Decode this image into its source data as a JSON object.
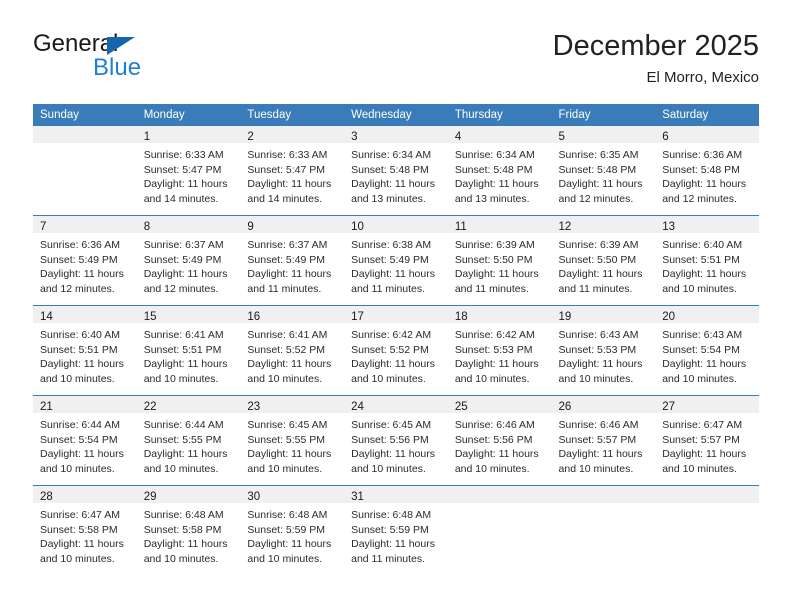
{
  "brand": {
    "name_top": "General",
    "name_bottom": "Blue",
    "triangle_icon": "triangle-icon",
    "accent_color": "#1f7fd4",
    "triangle_color": "#1565b0"
  },
  "header": {
    "title": "December 2025",
    "subtitle": "El Morro, Mexico"
  },
  "theme": {
    "header_blue": "#3a7cb9",
    "daynum_band": "#f0f0f0",
    "body_white": "#ffffff",
    "text_color": "#2b2b2b"
  },
  "weekdays": [
    "Sunday",
    "Monday",
    "Tuesday",
    "Wednesday",
    "Thursday",
    "Friday",
    "Saturday"
  ],
  "weeks": [
    [
      {
        "day": "",
        "sunrise": "",
        "sunset": "",
        "daylight_line1": "",
        "daylight_line2": ""
      },
      {
        "day": "1",
        "sunrise": "Sunrise: 6:33 AM",
        "sunset": "Sunset: 5:47 PM",
        "daylight_line1": "Daylight: 11 hours",
        "daylight_line2": "and 14 minutes."
      },
      {
        "day": "2",
        "sunrise": "Sunrise: 6:33 AM",
        "sunset": "Sunset: 5:47 PM",
        "daylight_line1": "Daylight: 11 hours",
        "daylight_line2": "and 14 minutes."
      },
      {
        "day": "3",
        "sunrise": "Sunrise: 6:34 AM",
        "sunset": "Sunset: 5:48 PM",
        "daylight_line1": "Daylight: 11 hours",
        "daylight_line2": "and 13 minutes."
      },
      {
        "day": "4",
        "sunrise": "Sunrise: 6:34 AM",
        "sunset": "Sunset: 5:48 PM",
        "daylight_line1": "Daylight: 11 hours",
        "daylight_line2": "and 13 minutes."
      },
      {
        "day": "5",
        "sunrise": "Sunrise: 6:35 AM",
        "sunset": "Sunset: 5:48 PM",
        "daylight_line1": "Daylight: 11 hours",
        "daylight_line2": "and 12 minutes."
      },
      {
        "day": "6",
        "sunrise": "Sunrise: 6:36 AM",
        "sunset": "Sunset: 5:48 PM",
        "daylight_line1": "Daylight: 11 hours",
        "daylight_line2": "and 12 minutes."
      }
    ],
    [
      {
        "day": "7",
        "sunrise": "Sunrise: 6:36 AM",
        "sunset": "Sunset: 5:49 PM",
        "daylight_line1": "Daylight: 11 hours",
        "daylight_line2": "and 12 minutes."
      },
      {
        "day": "8",
        "sunrise": "Sunrise: 6:37 AM",
        "sunset": "Sunset: 5:49 PM",
        "daylight_line1": "Daylight: 11 hours",
        "daylight_line2": "and 12 minutes."
      },
      {
        "day": "9",
        "sunrise": "Sunrise: 6:37 AM",
        "sunset": "Sunset: 5:49 PM",
        "daylight_line1": "Daylight: 11 hours",
        "daylight_line2": "and 11 minutes."
      },
      {
        "day": "10",
        "sunrise": "Sunrise: 6:38 AM",
        "sunset": "Sunset: 5:49 PM",
        "daylight_line1": "Daylight: 11 hours",
        "daylight_line2": "and 11 minutes."
      },
      {
        "day": "11",
        "sunrise": "Sunrise: 6:39 AM",
        "sunset": "Sunset: 5:50 PM",
        "daylight_line1": "Daylight: 11 hours",
        "daylight_line2": "and 11 minutes."
      },
      {
        "day": "12",
        "sunrise": "Sunrise: 6:39 AM",
        "sunset": "Sunset: 5:50 PM",
        "daylight_line1": "Daylight: 11 hours",
        "daylight_line2": "and 11 minutes."
      },
      {
        "day": "13",
        "sunrise": "Sunrise: 6:40 AM",
        "sunset": "Sunset: 5:51 PM",
        "daylight_line1": "Daylight: 11 hours",
        "daylight_line2": "and 10 minutes."
      }
    ],
    [
      {
        "day": "14",
        "sunrise": "Sunrise: 6:40 AM",
        "sunset": "Sunset: 5:51 PM",
        "daylight_line1": "Daylight: 11 hours",
        "daylight_line2": "and 10 minutes."
      },
      {
        "day": "15",
        "sunrise": "Sunrise: 6:41 AM",
        "sunset": "Sunset: 5:51 PM",
        "daylight_line1": "Daylight: 11 hours",
        "daylight_line2": "and 10 minutes."
      },
      {
        "day": "16",
        "sunrise": "Sunrise: 6:41 AM",
        "sunset": "Sunset: 5:52 PM",
        "daylight_line1": "Daylight: 11 hours",
        "daylight_line2": "and 10 minutes."
      },
      {
        "day": "17",
        "sunrise": "Sunrise: 6:42 AM",
        "sunset": "Sunset: 5:52 PM",
        "daylight_line1": "Daylight: 11 hours",
        "daylight_line2": "and 10 minutes."
      },
      {
        "day": "18",
        "sunrise": "Sunrise: 6:42 AM",
        "sunset": "Sunset: 5:53 PM",
        "daylight_line1": "Daylight: 11 hours",
        "daylight_line2": "and 10 minutes."
      },
      {
        "day": "19",
        "sunrise": "Sunrise: 6:43 AM",
        "sunset": "Sunset: 5:53 PM",
        "daylight_line1": "Daylight: 11 hours",
        "daylight_line2": "and 10 minutes."
      },
      {
        "day": "20",
        "sunrise": "Sunrise: 6:43 AM",
        "sunset": "Sunset: 5:54 PM",
        "daylight_line1": "Daylight: 11 hours",
        "daylight_line2": "and 10 minutes."
      }
    ],
    [
      {
        "day": "21",
        "sunrise": "Sunrise: 6:44 AM",
        "sunset": "Sunset: 5:54 PM",
        "daylight_line1": "Daylight: 11 hours",
        "daylight_line2": "and 10 minutes."
      },
      {
        "day": "22",
        "sunrise": "Sunrise: 6:44 AM",
        "sunset": "Sunset: 5:55 PM",
        "daylight_line1": "Daylight: 11 hours",
        "daylight_line2": "and 10 minutes."
      },
      {
        "day": "23",
        "sunrise": "Sunrise: 6:45 AM",
        "sunset": "Sunset: 5:55 PM",
        "daylight_line1": "Daylight: 11 hours",
        "daylight_line2": "and 10 minutes."
      },
      {
        "day": "24",
        "sunrise": "Sunrise: 6:45 AM",
        "sunset": "Sunset: 5:56 PM",
        "daylight_line1": "Daylight: 11 hours",
        "daylight_line2": "and 10 minutes."
      },
      {
        "day": "25",
        "sunrise": "Sunrise: 6:46 AM",
        "sunset": "Sunset: 5:56 PM",
        "daylight_line1": "Daylight: 11 hours",
        "daylight_line2": "and 10 minutes."
      },
      {
        "day": "26",
        "sunrise": "Sunrise: 6:46 AM",
        "sunset": "Sunset: 5:57 PM",
        "daylight_line1": "Daylight: 11 hours",
        "daylight_line2": "and 10 minutes."
      },
      {
        "day": "27",
        "sunrise": "Sunrise: 6:47 AM",
        "sunset": "Sunset: 5:57 PM",
        "daylight_line1": "Daylight: 11 hours",
        "daylight_line2": "and 10 minutes."
      }
    ],
    [
      {
        "day": "28",
        "sunrise": "Sunrise: 6:47 AM",
        "sunset": "Sunset: 5:58 PM",
        "daylight_line1": "Daylight: 11 hours",
        "daylight_line2": "and 10 minutes."
      },
      {
        "day": "29",
        "sunrise": "Sunrise: 6:48 AM",
        "sunset": "Sunset: 5:58 PM",
        "daylight_line1": "Daylight: 11 hours",
        "daylight_line2": "and 10 minutes."
      },
      {
        "day": "30",
        "sunrise": "Sunrise: 6:48 AM",
        "sunset": "Sunset: 5:59 PM",
        "daylight_line1": "Daylight: 11 hours",
        "daylight_line2": "and 10 minutes."
      },
      {
        "day": "31",
        "sunrise": "Sunrise: 6:48 AM",
        "sunset": "Sunset: 5:59 PM",
        "daylight_line1": "Daylight: 11 hours",
        "daylight_line2": "and 11 minutes."
      },
      {
        "day": "",
        "sunrise": "",
        "sunset": "",
        "daylight_line1": "",
        "daylight_line2": ""
      },
      {
        "day": "",
        "sunrise": "",
        "sunset": "",
        "daylight_line1": "",
        "daylight_line2": ""
      },
      {
        "day": "",
        "sunrise": "",
        "sunset": "",
        "daylight_line1": "",
        "daylight_line2": ""
      }
    ]
  ]
}
